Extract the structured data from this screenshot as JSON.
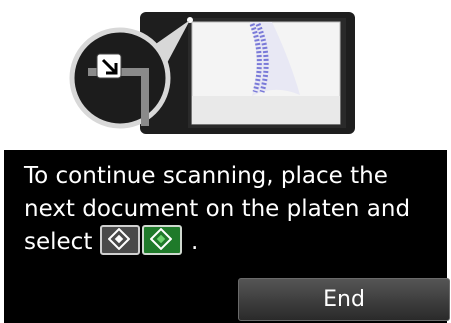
{
  "message": {
    "text": "To continue scanning, place the next document on the platen and select",
    "suffix": "."
  },
  "buttons": {
    "end_label": "End"
  },
  "icons": {
    "mono_start": "black-start-button-icon",
    "color_start": "color-start-button-icon",
    "zoom_corner": "platen-corner-alignment-icon",
    "document": "document-on-platen-icon"
  },
  "colors": {
    "panel": "#000000",
    "text": "#ffffff",
    "color_start": "#1f7a2a"
  }
}
